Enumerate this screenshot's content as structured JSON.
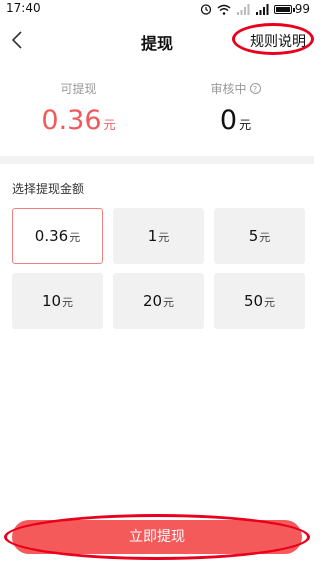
{
  "status_bar": {
    "time": "17:40",
    "battery": "99"
  },
  "header": {
    "title": "提现",
    "rules_link": "规则说明"
  },
  "balances": {
    "withdrawable": {
      "label": "可提现",
      "value": "0.36",
      "unit": "元"
    },
    "reviewing": {
      "label": "审核中",
      "help": "?",
      "value": "0",
      "unit": "元"
    }
  },
  "amount_section": {
    "title": "选择提现金额",
    "options": [
      {
        "value": "0.36",
        "unit": "元"
      },
      {
        "value": "1",
        "unit": "元"
      },
      {
        "value": "5",
        "unit": "元"
      },
      {
        "value": "10",
        "unit": "元"
      },
      {
        "value": "20",
        "unit": "元"
      },
      {
        "value": "50",
        "unit": "元"
      }
    ]
  },
  "submit_button": {
    "label": "立即提现"
  },
  "colors": {
    "accent": "#f45a5a",
    "annotation": "#e8001c"
  }
}
